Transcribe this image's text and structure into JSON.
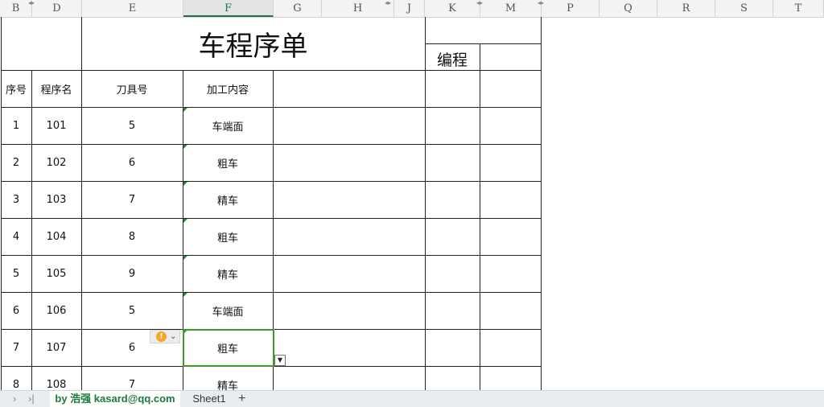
{
  "column_headers": [
    "B",
    "D",
    "E",
    "F",
    "G",
    "H",
    "J",
    "K",
    "M",
    "P",
    "Q",
    "R",
    "S",
    "T"
  ],
  "active_column": "F",
  "sheet": {
    "title": "车程序单",
    "programmer_label": "编程",
    "headers": {
      "seq": "序号",
      "program_name": "程序名",
      "tool_no": "刀具号",
      "content": "加工内容"
    },
    "rows": [
      {
        "seq": "1",
        "program": "101",
        "tool": "5",
        "content": "车端面"
      },
      {
        "seq": "2",
        "program": "102",
        "tool": "6",
        "content": "粗车"
      },
      {
        "seq": "3",
        "program": "103",
        "tool": "7",
        "content": "精车"
      },
      {
        "seq": "4",
        "program": "104",
        "tool": "8",
        "content": "粗车"
      },
      {
        "seq": "5",
        "program": "105",
        "tool": "9",
        "content": "精车"
      },
      {
        "seq": "6",
        "program": "106",
        "tool": "5",
        "content": "车端面"
      },
      {
        "seq": "7",
        "program": "107",
        "tool": "6",
        "content": "粗车"
      },
      {
        "seq": "8",
        "program": "108",
        "tool": "7",
        "content": "精车"
      }
    ]
  },
  "tabs": {
    "sheet1": "by 浩强 kasard@qq.com",
    "sheet2": "Sheet1",
    "add": "+"
  },
  "icons": {
    "warning": "warning-icon",
    "dropdown": "dropdown-arrow-icon",
    "nav_next": "chevron-right-icon",
    "nav_last": "last-sheet-icon"
  },
  "colors": {
    "accent": "#217346",
    "selection": "#3f9a2b",
    "warning": "#f5a623"
  }
}
